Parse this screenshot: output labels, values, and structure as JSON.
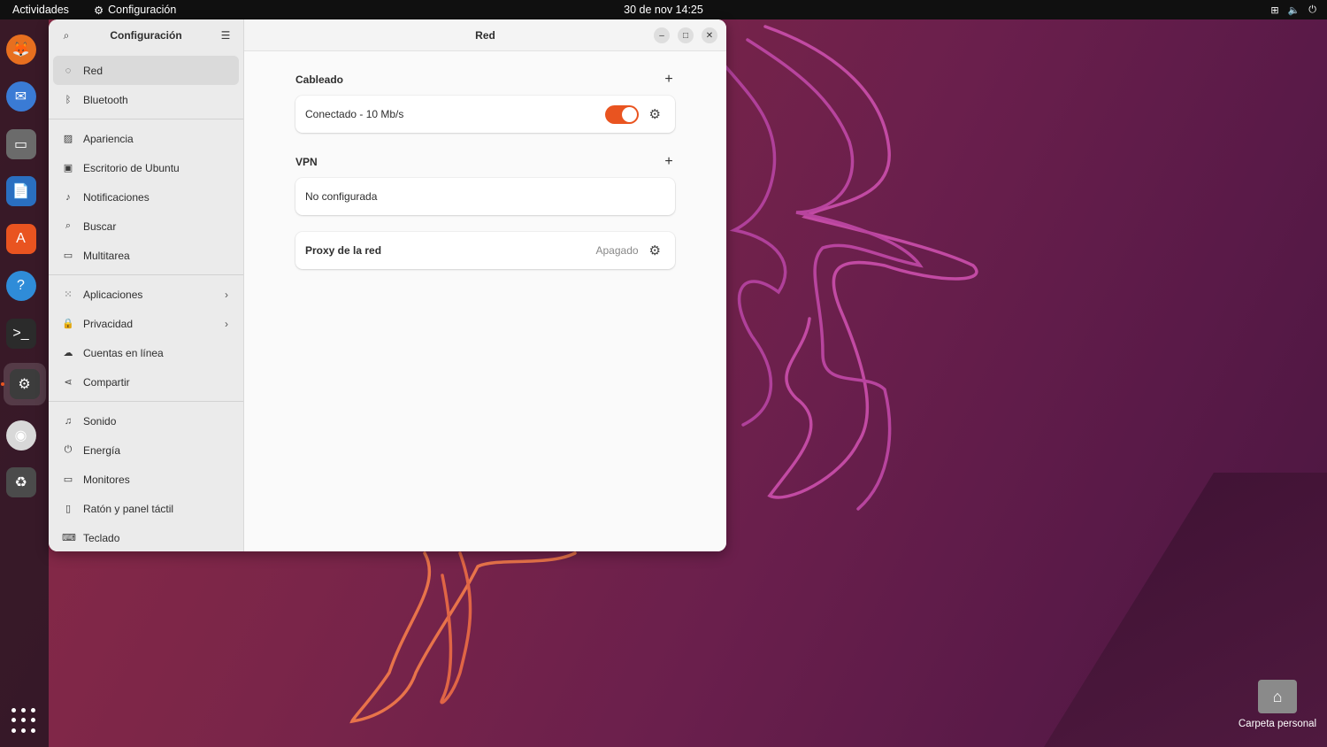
{
  "topbar": {
    "activities": "Actividades",
    "app_name": "Configuración",
    "clock": "30 de nov  14:25"
  },
  "dock": {
    "items": [
      {
        "name": "firefox",
        "glyph": "🦊"
      },
      {
        "name": "thunderbird",
        "glyph": "✉"
      },
      {
        "name": "files",
        "glyph": "▭"
      },
      {
        "name": "writer",
        "glyph": "📄"
      },
      {
        "name": "software",
        "glyph": "A"
      },
      {
        "name": "help",
        "glyph": "?"
      },
      {
        "name": "terminal",
        "glyph": ">_"
      },
      {
        "name": "settings",
        "glyph": "⚙"
      },
      {
        "name": "disc",
        "glyph": "◉"
      },
      {
        "name": "trash",
        "glyph": "♻"
      }
    ]
  },
  "sidebar": {
    "title": "Configuración",
    "groups": [
      [
        {
          "label": "Red",
          "icon": "network-icon",
          "glyph": "◌"
        },
        {
          "label": "Bluetooth",
          "icon": "bluetooth-icon",
          "glyph": "ᛒ"
        }
      ],
      [
        {
          "label": "Apariencia",
          "icon": "appearance-icon",
          "glyph": "▨"
        },
        {
          "label": "Escritorio de Ubuntu",
          "icon": "desktop-icon",
          "glyph": "▣"
        },
        {
          "label": "Notificaciones",
          "icon": "bell-icon",
          "glyph": "♪"
        },
        {
          "label": "Buscar",
          "icon": "search-icon",
          "glyph": "⌕"
        },
        {
          "label": "Multitarea",
          "icon": "multitask-icon",
          "glyph": "▭"
        }
      ],
      [
        {
          "label": "Aplicaciones",
          "icon": "apps-icon",
          "glyph": "⁙",
          "chevron": true
        },
        {
          "label": "Privacidad",
          "icon": "lock-icon",
          "glyph": "🔒",
          "chevron": true
        },
        {
          "label": "Cuentas en línea",
          "icon": "cloud-icon",
          "glyph": "☁"
        },
        {
          "label": "Compartir",
          "icon": "share-icon",
          "glyph": "⋖"
        }
      ],
      [
        {
          "label": "Sonido",
          "icon": "music-icon",
          "glyph": "♫"
        },
        {
          "label": "Energía",
          "icon": "power-icon",
          "glyph": "⏻"
        },
        {
          "label": "Monitores",
          "icon": "monitor-icon",
          "glyph": "▭"
        },
        {
          "label": "Ratón y panel táctil",
          "icon": "mouse-icon",
          "glyph": "▯"
        },
        {
          "label": "Teclado",
          "icon": "keyboard-icon",
          "glyph": "⌨"
        }
      ]
    ]
  },
  "main": {
    "title": "Red",
    "wired": {
      "heading": "Cableado",
      "connection": "Conectado - 10 Mb/s",
      "enabled": true
    },
    "vpn": {
      "heading": "VPN",
      "status": "No configurada"
    },
    "proxy": {
      "label": "Proxy de la red",
      "status": "Apagado"
    }
  },
  "desktop": {
    "home_folder": "Carpeta personal"
  },
  "colors": {
    "accent": "#e95420"
  }
}
